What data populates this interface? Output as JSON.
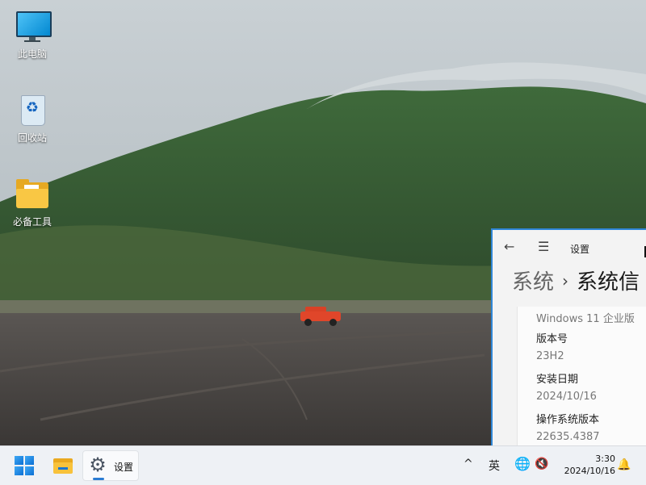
{
  "desktop": {
    "icons": [
      {
        "label": "此电脑",
        "icon": "computer-icon"
      },
      {
        "label": "回收站",
        "icon": "recycle-bin-icon"
      },
      {
        "label": "必备工具",
        "icon": "folder-icon"
      }
    ]
  },
  "settings_window": {
    "title": "设置",
    "breadcrumb": {
      "parent": "系统",
      "separator": "›",
      "current": "系统信"
    },
    "rows": [
      {
        "text": "Windows 11 企业版",
        "kind": "value"
      },
      {
        "text": "版本号",
        "kind": "key"
      },
      {
        "text": "23H2",
        "kind": "value"
      },
      {
        "text": "安装日期",
        "kind": "key"
      },
      {
        "text": "2024/10/16",
        "kind": "value"
      },
      {
        "text": "操作系统版本",
        "kind": "key"
      },
      {
        "text": "22635.4387",
        "kind": "value"
      }
    ]
  },
  "taskbar": {
    "start_icon": "windows-logo-icon",
    "explorer_icon": "file-explorer-icon",
    "settings_app_label": "设置",
    "tray": {
      "chevron": "^",
      "ime": "英",
      "time": "3:30",
      "date": "2024/10/16"
    }
  },
  "colors": {
    "accent": "#2f86d6",
    "taskbar_bg": "#eef1f5"
  }
}
